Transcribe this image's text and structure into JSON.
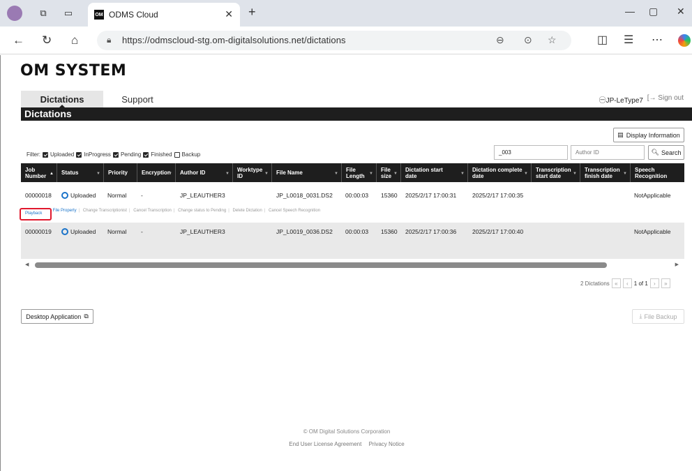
{
  "browser": {
    "tab_title": "ODMS Cloud",
    "tab_favicon": "OM",
    "url": "https://odmscloud-stg.om-digitalsolutions.net/dictations"
  },
  "app": {
    "logo": "OM SYSTEM",
    "nav": [
      "Dictations",
      "Support"
    ],
    "user": "JP-LeType7",
    "sign_out": "Sign out",
    "section_title": "Dictations",
    "display_info": "Display Information",
    "filter_label": "Filter:",
    "filters": [
      {
        "label": "Uploaded",
        "checked": true
      },
      {
        "label": "InProgress",
        "checked": true
      },
      {
        "label": "Pending",
        "checked": true
      },
      {
        "label": "Finished",
        "checked": true
      },
      {
        "label": "Backup",
        "checked": false
      }
    ],
    "search_file_value": "_003",
    "search_author_placeholder": "Author ID",
    "search_button": "Search"
  },
  "table": {
    "columns": [
      "Job Number",
      "Status",
      "Priority",
      "Encryption",
      "Author ID",
      "Worktype ID",
      "File Name",
      "File Length",
      "File size",
      "Dictation start date",
      "Dictation complete date",
      "Transcription start date",
      "Transcription finish date",
      "Speech Recognition"
    ],
    "rows": [
      {
        "job": "00000018",
        "status": "Uploaded",
        "priority": "Normal",
        "encryption": "-",
        "author": "JP_LEAUTHER3",
        "worktype": "",
        "file": "JP_L0018_0031.DS2",
        "length": "00:00:03",
        "size": "15360",
        "start": "2025/2/17 17:00:31",
        "complete": "2025/2/17 17:00:35",
        "speech": "NotApplicable"
      },
      {
        "job": "00000019",
        "status": "Uploaded",
        "priority": "Normal",
        "encryption": "-",
        "author": "JP_LEAUTHER3",
        "worktype": "",
        "file": "JP_L0019_0036.DS2",
        "length": "00:00:03",
        "size": "15360",
        "start": "2025/2/17 17:00:36",
        "complete": "2025/2/17 17:00:40",
        "speech": "NotApplicable"
      }
    ],
    "row_actions": [
      "Playback",
      "File Property",
      "Change Transcriptionist",
      "Cancel Transcription",
      "Change status to Pending",
      "Delete Dictation",
      "Cancel Speech Recognition"
    ]
  },
  "pagination": {
    "count": "2 Dictations",
    "page": "1 of 1"
  },
  "buttons": {
    "desktop_app": "Desktop Application",
    "file_backup": "File Backup"
  },
  "footer": {
    "copyright": "© OM Digital Solutions Corporation",
    "links": [
      "End User License Agreement",
      "Privacy Notice"
    ]
  },
  "colors": {
    "accent_blue": "#1a73c9",
    "highlight_red": "#e0182d",
    "header_dark": "#1e1e1e"
  }
}
